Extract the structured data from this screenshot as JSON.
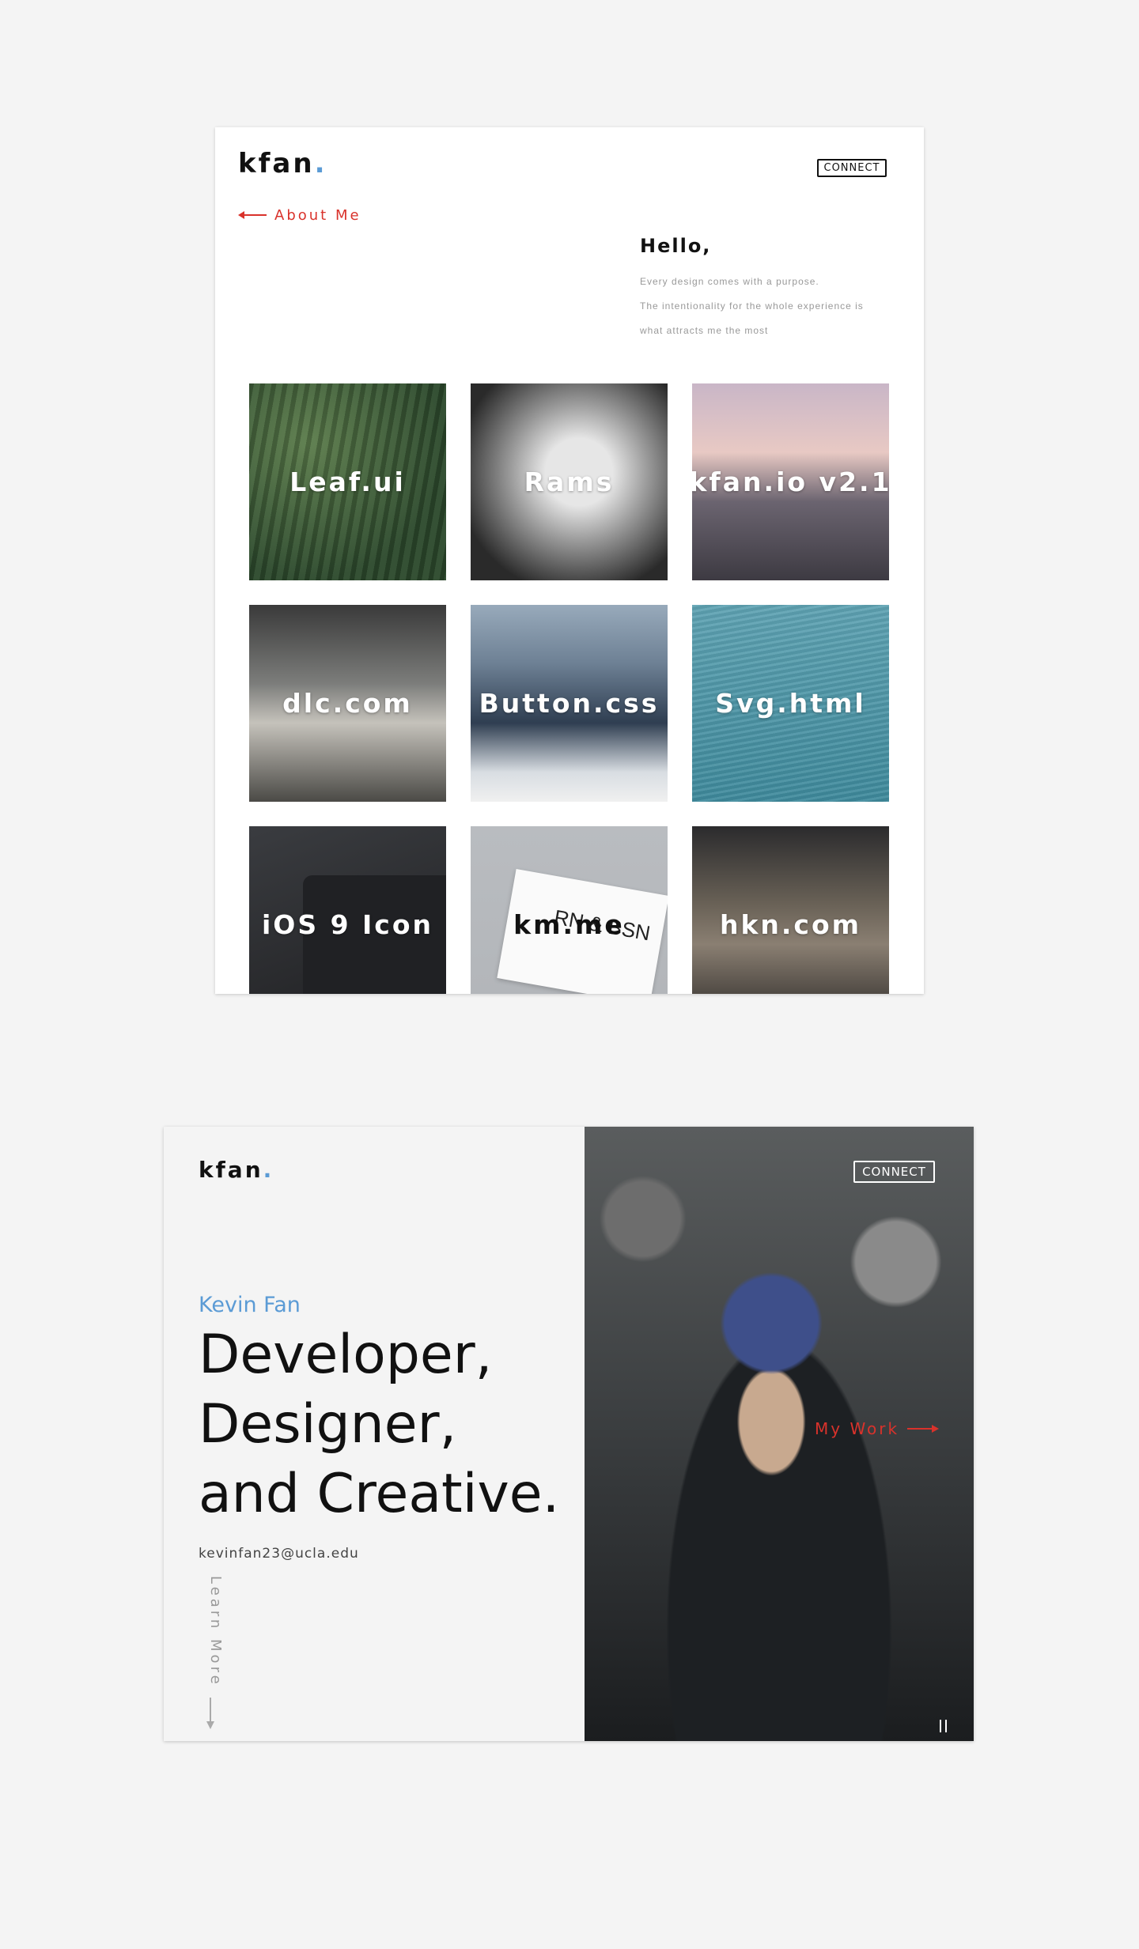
{
  "card1": {
    "logo": "kfan",
    "logo_dot": ".",
    "connect_label": "CONNECT",
    "about_link": "About Me",
    "hello_title": "Hello,",
    "intro_lines": [
      "Every design comes with a purpose.",
      "The intentionality for the whole experience is",
      "what attracts me the most"
    ],
    "projects": [
      {
        "label": "Leaf.ui"
      },
      {
        "label": "Rams"
      },
      {
        "label": "kfan.io v2.1"
      },
      {
        "label": "dlc.com"
      },
      {
        "label": "Button.css"
      },
      {
        "label": "Svg.html"
      },
      {
        "label": "iOS 9 Icon"
      },
      {
        "label": "km.me"
      },
      {
        "label": "hkn.com"
      }
    ],
    "card_note": "RN & BSN"
  },
  "card2": {
    "logo": "kfan",
    "logo_dot": ".",
    "name": "Kevin Fan",
    "headline": [
      "Developer,",
      "Designer,",
      "and Creative."
    ],
    "email": "kevinfan23@ucla.edu",
    "learn_more": "Learn More",
    "connect_label": "CONNECT",
    "my_work": "My Work"
  },
  "colors": {
    "accent_blue": "#5b9bd5",
    "accent_red": "#d9322b",
    "background": "#f4f4f4"
  }
}
